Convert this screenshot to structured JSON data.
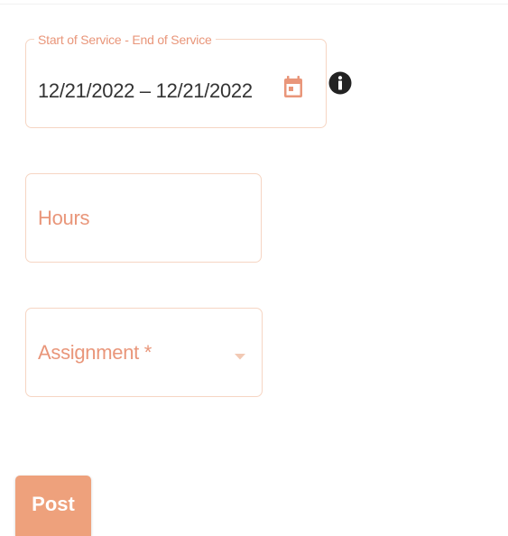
{
  "service_dates": {
    "label": "Start of Service - End of Service",
    "value": "12/21/2022 – 12/21/2022",
    "icon": "calendar-icon"
  },
  "info": {
    "icon": "info-icon"
  },
  "hours": {
    "placeholder": "Hours"
  },
  "assignment": {
    "placeholder": "Assignment *",
    "icon": "caret-down-icon"
  },
  "actions": {
    "post_label": "Post"
  },
  "colors": {
    "accent": "#e9967a",
    "border": "#f6d5c3",
    "button": "#eea17c",
    "text": "#333333",
    "info": "#222222"
  }
}
